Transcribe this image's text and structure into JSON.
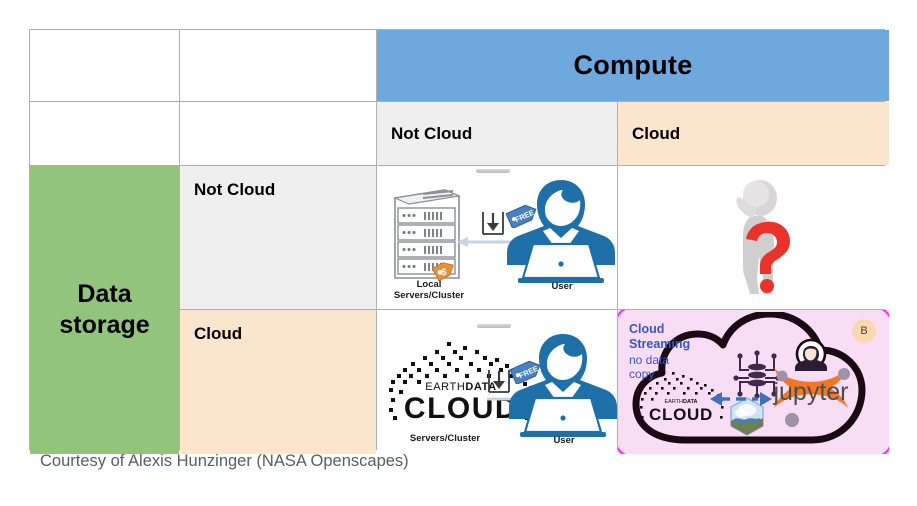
{
  "figure": {
    "caption": "Courtesy of Alexis Hunzinger (NASA Openscapes)",
    "colors": {
      "compute_header": "#6fa8dc",
      "storage_header": "#93c47d",
      "not_cloud": "#efefef",
      "cloud": "#fce5cd",
      "highlight_border": "#ff2cf0",
      "highlight_fill": "#f9ddf5",
      "accent_blue": "#1f6fa8",
      "accent_orange": "#f37726",
      "question_red": "#e8322a",
      "streaming_text": "#3b55c4"
    }
  },
  "matrix": {
    "column_axis_label": "Compute",
    "row_axis_label": "Data\nstorage",
    "row_axis_line1": "Data",
    "row_axis_line2": "storage",
    "column_headers": [
      "Not Cloud",
      "Cloud"
    ],
    "row_headers": [
      "Not Cloud",
      "Cloud"
    ]
  },
  "cells": {
    "not_cloud_not_cloud": {
      "name": "local-storage-local-compute",
      "server_label_line1": "Local",
      "server_label_line2": "Servers/Cluster",
      "user_label": "User",
      "download_tag_label": "FREE",
      "cost_tag_label": "$",
      "icons": [
        "server-rack-icon",
        "download-arrow-icon",
        "free-tag-icon",
        "cost-tag-icon",
        "user-laptop-icon"
      ]
    },
    "not_cloud_cloud": {
      "name": "local-storage-cloud-compute",
      "icons": [
        "thinking-person-icon",
        "question-mark-icon"
      ],
      "description": "Person thinking with a red question mark"
    },
    "cloud_not_cloud": {
      "name": "cloud-storage-local-compute",
      "logo_line1": "EARTHDATA",
      "logo_line2": "CLOUD",
      "logo_earth": "EARTH",
      "logo_data": "DATA",
      "server_label": "Servers/Cluster",
      "user_label": "User",
      "download_tag_label": "FREE",
      "icons": [
        "earthdata-cloud-logo",
        "download-arrow-icon",
        "free-tag-icon",
        "user-laptop-icon"
      ]
    },
    "cloud_cloud": {
      "name": "cloud-storage-cloud-compute",
      "title_line1": "Cloud",
      "title_line2": "Streaming",
      "subtitle_line1": "no data",
      "subtitle_line2": "copy",
      "badge": "B",
      "logo_earth": "EARTH",
      "logo_data": "DATA",
      "logo_line2": "CLOUD",
      "jupyter_label": "jupyter",
      "icons": [
        "cloud-outline-icon",
        "earthdata-cloud-logo",
        "database-network-icon",
        "pangeo-hex-icon",
        "jupyter-logo-icon",
        "user-avatar-icon",
        "bidirectional-arrow-icon"
      ]
    }
  }
}
